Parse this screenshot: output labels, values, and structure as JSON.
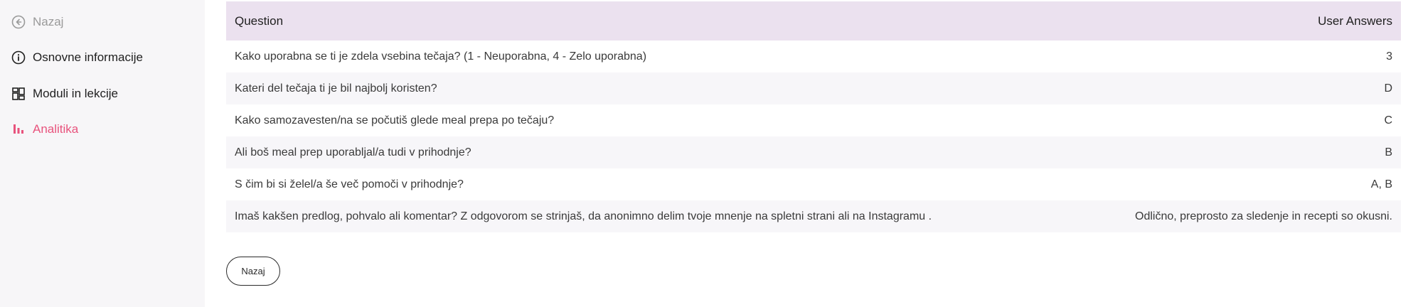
{
  "sidebar": {
    "items": [
      {
        "label": "Nazaj",
        "icon": "back-circle-icon"
      },
      {
        "label": "Osnovne informacije",
        "icon": "info-icon"
      },
      {
        "label": "Moduli in lekcije",
        "icon": "modules-grid-icon"
      },
      {
        "label": "Analitika",
        "icon": "bar-chart-icon",
        "active": true
      }
    ],
    "active_color": "#e8537d"
  },
  "table": {
    "headers": {
      "question": "Question",
      "answers": "User Answers"
    },
    "rows": [
      {
        "question": "Kako uporabna se ti je zdela vsebina tečaja? (1 - Neuporabna, 4 - Zelo uporabna)",
        "answer": "3"
      },
      {
        "question": "Kateri del tečaja ti je bil najbolj koristen?",
        "answer": "D"
      },
      {
        "question": "Kako samozavesten/na se počutiš glede meal prepa po tečaju?",
        "answer": "C"
      },
      {
        "question": "Ali boš meal prep uporabljal/a tudi v prihodnje?",
        "answer": "B"
      },
      {
        "question": "S čim bi si želel/a še več pomoči v prihodnje?",
        "answer": "A, B"
      },
      {
        "question": "Imaš kakšen predlog, pohvalo ali komentar? Z odgovorom se strinjaš, da anonimno delim tvoje mnenje na spletni strani ali na Instagramu .",
        "answer": "Odlično, preprosto za sledenje in recepti so okusni."
      }
    ],
    "header_bg": "#ebe1ef"
  },
  "footer": {
    "back_button_label": "Nazaj"
  }
}
